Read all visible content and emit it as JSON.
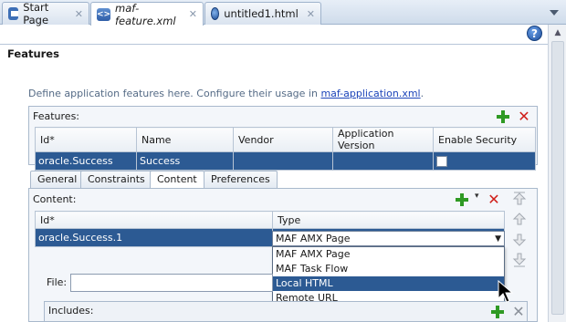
{
  "tabs": [
    {
      "label": "Start Page",
      "icon": "page-icon",
      "active": false
    },
    {
      "label": "maf-feature.xml",
      "icon": "xml-file-icon",
      "active": true
    },
    {
      "label": "untitled1.html",
      "icon": "html-file-icon",
      "active": false
    }
  ],
  "help_label": "?",
  "section_title": "Features",
  "description": {
    "text": "Define application features here. Configure their usage in ",
    "link": "maf-application.xml",
    "suffix": "."
  },
  "features_panel": {
    "title": "Features:",
    "columns": [
      "Id*",
      "Name",
      "Vendor",
      "Application Version",
      "Enable Security"
    ],
    "rows": [
      {
        "id": "oracle.Success",
        "name": "Success",
        "vendor": "",
        "app_version": "",
        "enable_security": false
      }
    ]
  },
  "sub_tabs": [
    "General",
    "Constraints",
    "Content",
    "Preferences"
  ],
  "active_sub_tab": "Content",
  "content_panel": {
    "title": "Content:",
    "columns": [
      "Id*",
      "Type"
    ],
    "rows": [
      {
        "id": "oracle.Success.1",
        "type": "MAF AMX Page"
      }
    ]
  },
  "type_dropdown": {
    "selected": "MAF AMX Page",
    "options": [
      "MAF AMX Page",
      "MAF Task Flow",
      "Local HTML",
      "Remote URL"
    ],
    "highlighted": "Local HTML"
  },
  "file_label": "File:",
  "file_value": "",
  "includes_label": "Includes:",
  "colors": {
    "selection": "#2c5a93",
    "add_green": "#2f9a24",
    "delete_red": "#d0201b",
    "link": "#1c44b9"
  }
}
